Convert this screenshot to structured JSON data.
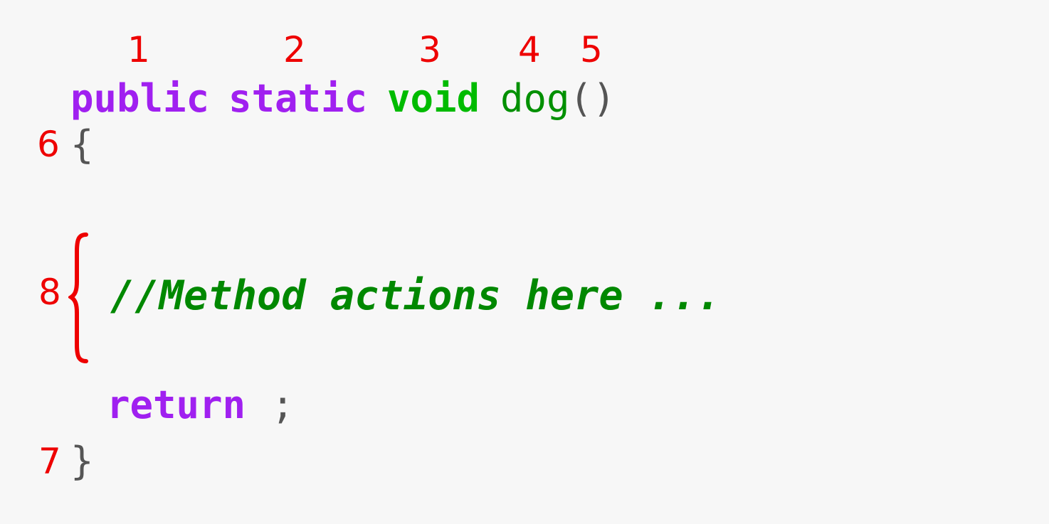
{
  "code": {
    "modifier_access": "public",
    "modifier_static": "static",
    "return_type": "void",
    "method_name": "dog",
    "params": "()",
    "open_brace": "{",
    "comment": "//Method actions here ...",
    "return_keyword": "return",
    "semicolon": ";",
    "close_brace": "}"
  },
  "annotations": {
    "n1": "1",
    "n2": "2",
    "n3": "3",
    "n4": "4",
    "n5": "5",
    "n6": "6",
    "n7": "7",
    "n8": "8"
  },
  "colors": {
    "annotation": "#ee0000",
    "keyword": "#a020f0",
    "type": "#00bb00",
    "identifier": "#009000",
    "comment": "#008800",
    "punctuation": "#555555",
    "background": "#f7f7f7"
  }
}
